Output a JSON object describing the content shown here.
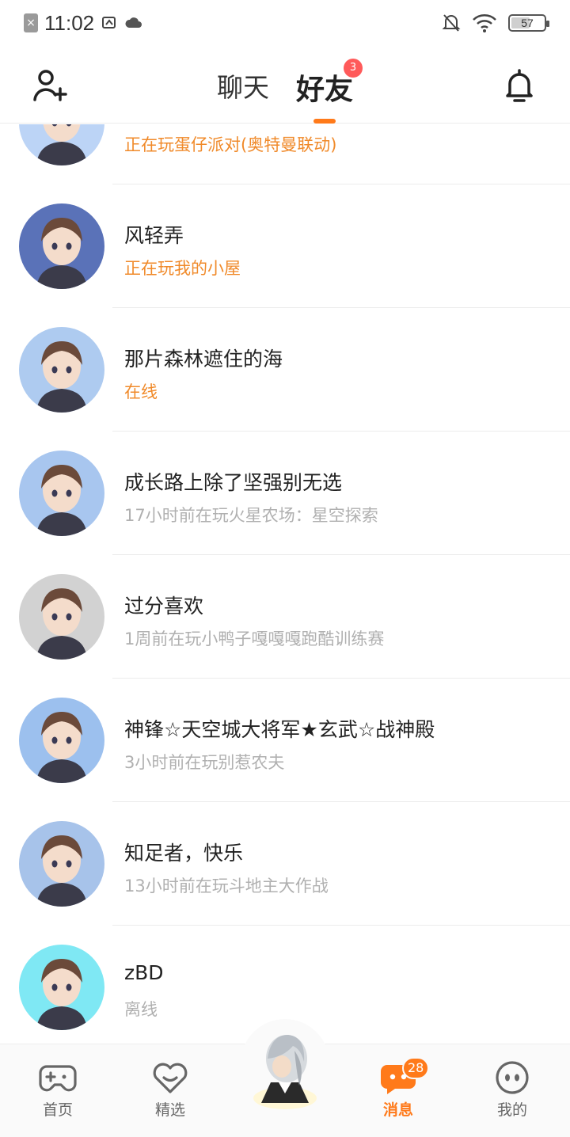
{
  "status_bar": {
    "time": "11:02",
    "battery": "57",
    "battery_level": 0.57
  },
  "header": {
    "tabs": [
      {
        "label": "聊天",
        "active": false
      },
      {
        "label": "好友",
        "active": true,
        "badge": "3"
      }
    ],
    "add_friend_icon": "add-user-icon",
    "notification_icon": "bell-icon"
  },
  "friends": [
    {
      "name": "",
      "status": "正在玩蛋仔派对(奥特曼联动)",
      "status_color": "orange",
      "avatar_bg": "#bcd4f6"
    },
    {
      "name": "风轻弄",
      "status": "正在玩我的小屋",
      "status_color": "orange",
      "avatar_bg": "#5a72b8"
    },
    {
      "name": "那片森林遮住的海",
      "status": "在线",
      "status_color": "orange",
      "avatar_bg": "#aecbf0"
    },
    {
      "name": "成长路上除了坚强别无选",
      "status": "17小时前在玩火星农场：星空探索",
      "status_color": "gray",
      "avatar_bg": "#a8c6ef"
    },
    {
      "name": "过分喜欢",
      "status": "1周前在玩小鸭子嘎嘎嘎跑酷训练赛",
      "status_color": "gray",
      "avatar_bg": "#d2d2d2"
    },
    {
      "name": "神锋☆天空城大将军★玄武☆战神殿",
      "status": "3小时前在玩别惹农夫",
      "status_color": "gray",
      "avatar_bg": "#9cc0ee"
    },
    {
      "name": "知足者，快乐",
      "status": "13小时前在玩斗地主大作战",
      "status_color": "gray",
      "avatar_bg": "#a7c3ea"
    },
    {
      "name": "zBD",
      "status": "离线",
      "status_color": "gray",
      "avatar_bg": "#7fe8f4"
    }
  ],
  "bottom_nav": [
    {
      "label": "首页",
      "icon": "gamepad-icon",
      "active": false
    },
    {
      "label": "精选",
      "icon": "heart-chat-icon",
      "active": false
    },
    {
      "label": "消息",
      "icon": "message-icon",
      "active": true,
      "badge": "28"
    },
    {
      "label": "我的",
      "icon": "face-icon",
      "active": false
    }
  ],
  "colors": {
    "accent": "#ff7a1a",
    "online": "#f08a2a",
    "offline": "#b0b0b0",
    "badge_red": "#ff5a5a"
  }
}
